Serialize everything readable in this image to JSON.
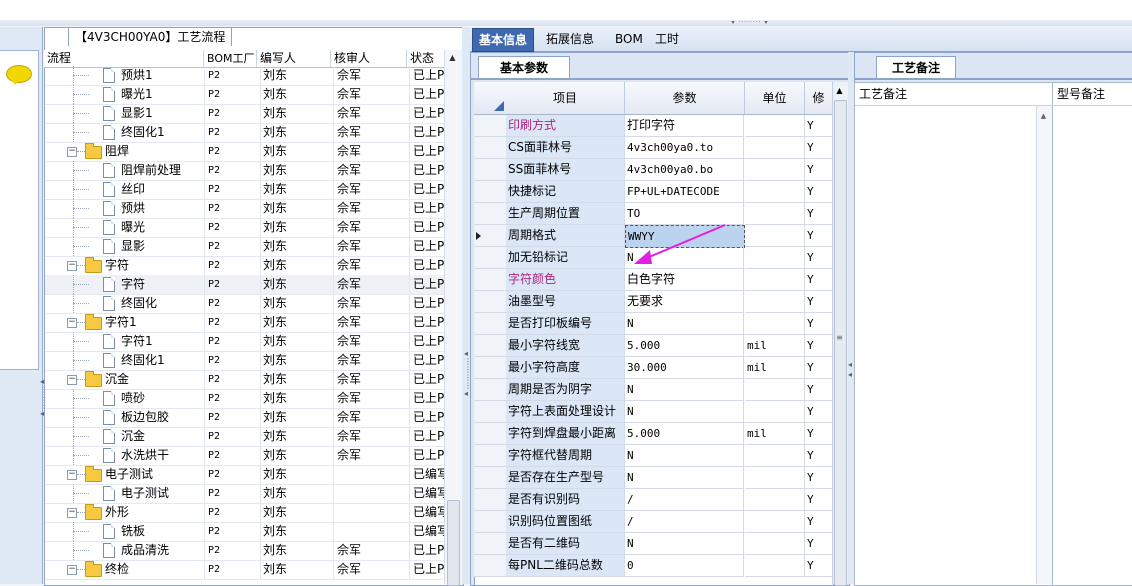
{
  "topbar": {
    "grip": "▾ ········ ▾"
  },
  "tree": {
    "title": "【4V3CH00YA0】工艺流程",
    "columns": [
      "流程",
      "BOM工厂",
      "编写人",
      "核审人",
      "状态"
    ],
    "rows": [
      {
        "level": 2,
        "type": "doc",
        "name": "预烘1",
        "bom": "P2",
        "writer": "刘东",
        "reviewer": "佘军",
        "status": "已上P"
      },
      {
        "level": 2,
        "type": "doc",
        "name": "曝光1",
        "bom": "P2",
        "writer": "刘东",
        "reviewer": "佘军",
        "status": "已上P"
      },
      {
        "level": 2,
        "type": "doc",
        "name": "显影1",
        "bom": "P2",
        "writer": "刘东",
        "reviewer": "佘军",
        "status": "已上P"
      },
      {
        "level": 2,
        "type": "doc",
        "name": "终固化1",
        "bom": "P2",
        "writer": "刘东",
        "reviewer": "佘军",
        "status": "已上P"
      },
      {
        "level": 1,
        "type": "folder",
        "name": "阻焊",
        "bom": "P2",
        "writer": "刘东",
        "reviewer": "佘军",
        "status": "已上P"
      },
      {
        "level": 2,
        "type": "doc",
        "name": "阻焊前处理",
        "bom": "P2",
        "writer": "刘东",
        "reviewer": "佘军",
        "status": "已上P"
      },
      {
        "level": 2,
        "type": "doc",
        "name": "丝印",
        "bom": "P2",
        "writer": "刘东",
        "reviewer": "佘军",
        "status": "已上P"
      },
      {
        "level": 2,
        "type": "doc",
        "name": "预烘",
        "bom": "P2",
        "writer": "刘东",
        "reviewer": "佘军",
        "status": "已上P"
      },
      {
        "level": 2,
        "type": "doc",
        "name": "曝光",
        "bom": "P2",
        "writer": "刘东",
        "reviewer": "佘军",
        "status": "已上P"
      },
      {
        "level": 2,
        "type": "doc",
        "name": "显影",
        "bom": "P2",
        "writer": "刘东",
        "reviewer": "佘军",
        "status": "已上P"
      },
      {
        "level": 1,
        "type": "folder",
        "name": "字符",
        "bom": "P2",
        "writer": "刘东",
        "reviewer": "佘军",
        "status": "已上P"
      },
      {
        "level": 2,
        "type": "doc",
        "name": "字符",
        "bom": "P2",
        "writer": "刘东",
        "reviewer": "佘军",
        "status": "已上P",
        "selected": true
      },
      {
        "level": 2,
        "type": "doc",
        "name": "终固化",
        "bom": "P2",
        "writer": "刘东",
        "reviewer": "佘军",
        "status": "已上P"
      },
      {
        "level": 1,
        "type": "folder",
        "name": "字符1",
        "bom": "P2",
        "writer": "刘东",
        "reviewer": "佘军",
        "status": "已上P"
      },
      {
        "level": 2,
        "type": "doc",
        "name": "字符1",
        "bom": "P2",
        "writer": "刘东",
        "reviewer": "佘军",
        "status": "已上P"
      },
      {
        "level": 2,
        "type": "doc",
        "name": "终固化1",
        "bom": "P2",
        "writer": "刘东",
        "reviewer": "佘军",
        "status": "已上P"
      },
      {
        "level": 1,
        "type": "folder",
        "name": "沉金",
        "bom": "P2",
        "writer": "刘东",
        "reviewer": "佘军",
        "status": "已上P"
      },
      {
        "level": 2,
        "type": "doc",
        "name": "喷砂",
        "bom": "P2",
        "writer": "刘东",
        "reviewer": "佘军",
        "status": "已上P"
      },
      {
        "level": 2,
        "type": "doc",
        "name": "板边包胶",
        "bom": "P2",
        "writer": "刘东",
        "reviewer": "佘军",
        "status": "已上P"
      },
      {
        "level": 2,
        "type": "doc",
        "name": "沉金",
        "bom": "P2",
        "writer": "刘东",
        "reviewer": "佘军",
        "status": "已上P"
      },
      {
        "level": 2,
        "type": "doc",
        "name": "水洗烘干",
        "bom": "P2",
        "writer": "刘东",
        "reviewer": "佘军",
        "status": "已上P"
      },
      {
        "level": 1,
        "type": "folder",
        "name": "电子测试",
        "bom": "P2",
        "writer": "刘东",
        "reviewer": "",
        "status": "已编写"
      },
      {
        "level": 2,
        "type": "doc",
        "name": "电子测试",
        "bom": "P2",
        "writer": "刘东",
        "reviewer": "",
        "status": "已编写"
      },
      {
        "level": 1,
        "type": "folder",
        "name": "外形",
        "bom": "P2",
        "writer": "刘东",
        "reviewer": "",
        "status": "已编写"
      },
      {
        "level": 2,
        "type": "doc",
        "name": "铣板",
        "bom": "P2",
        "writer": "刘东",
        "reviewer": "",
        "status": "已编写"
      },
      {
        "level": 2,
        "type": "doc",
        "name": "成品清洗",
        "bom": "P2",
        "writer": "刘东",
        "reviewer": "佘军",
        "status": "已上P"
      },
      {
        "level": 1,
        "type": "folder",
        "name": "终检",
        "bom": "P2",
        "writer": "刘东",
        "reviewer": "佘军",
        "status": "已上P"
      }
    ]
  },
  "tabs": [
    {
      "label": "基本信息",
      "active": true
    },
    {
      "label": "拓展信息",
      "active": false
    },
    {
      "label": "BOM",
      "active": false
    },
    {
      "label": "工时",
      "active": false
    }
  ],
  "params": {
    "subtab": "基本参数",
    "columns": [
      "项目",
      "参数",
      "单位",
      "修"
    ],
    "rows": [
      {
        "item": "印刷方式",
        "value": "打印字符",
        "unit": "",
        "flag": "Y",
        "pink": true
      },
      {
        "item": "CS面菲林号",
        "value": "4v3ch00ya0.to",
        "unit": "",
        "flag": "Y",
        "mono": true
      },
      {
        "item": "SS面菲林号",
        "value": "4v3ch00ya0.bo",
        "unit": "",
        "flag": "Y",
        "mono": true
      },
      {
        "item": "快捷标记",
        "value": "FP+UL+DATECODE",
        "unit": "",
        "flag": "Y",
        "mono": true
      },
      {
        "item": "生产周期位置",
        "value": "TO",
        "unit": "",
        "flag": "Y",
        "mono": true
      },
      {
        "item": "周期格式",
        "value": "WWYY",
        "unit": "",
        "flag": "Y",
        "mono": true,
        "current": true
      },
      {
        "item": "加无铅标记",
        "value": "N",
        "unit": "",
        "flag": "Y",
        "mono": true
      },
      {
        "item": "字符颜色",
        "value": "白色字符",
        "unit": "",
        "flag": "Y",
        "pink": true
      },
      {
        "item": "油墨型号",
        "value": "无要求",
        "unit": "",
        "flag": "Y"
      },
      {
        "item": "是否打印板编号",
        "value": "N",
        "unit": "",
        "flag": "Y",
        "mono": true
      },
      {
        "item": "最小字符线宽",
        "value": "5.000",
        "unit": "mil",
        "flag": "Y",
        "mono": true
      },
      {
        "item": "最小字符高度",
        "value": "30.000",
        "unit": "mil",
        "flag": "Y",
        "mono": true
      },
      {
        "item": "周期是否为阴字",
        "value": "N",
        "unit": "",
        "flag": "Y",
        "mono": true
      },
      {
        "item": "字符上表面处理设计",
        "value": "N",
        "unit": "",
        "flag": "Y",
        "mono": true
      },
      {
        "item": "字符到焊盘最小距离",
        "value": "5.000",
        "unit": "mil",
        "flag": "Y",
        "mono": true
      },
      {
        "item": "字符框代替周期",
        "value": "N",
        "unit": "",
        "flag": "Y",
        "mono": true
      },
      {
        "item": "是否存在生产型号",
        "value": "N",
        "unit": "",
        "flag": "Y",
        "mono": true
      },
      {
        "item": "是否有识别码",
        "value": "/",
        "unit": "",
        "flag": "Y",
        "mono": true
      },
      {
        "item": "识别码位置图纸",
        "value": "/",
        "unit": "",
        "flag": "Y",
        "mono": true
      },
      {
        "item": "是否有二维码",
        "value": "N",
        "unit": "",
        "flag": "Y",
        "mono": true
      },
      {
        "item": "每PNL二维码总数",
        "value": "0",
        "unit": "",
        "flag": "Y",
        "mono": true
      }
    ]
  },
  "notes": {
    "subtab": "工艺备注",
    "col1": "工艺备注",
    "col2": "型号备注"
  },
  "colors": {
    "accent": "#3e68b0",
    "pink_label": "#b0247c",
    "annotation_arrow": "#e020e0"
  }
}
